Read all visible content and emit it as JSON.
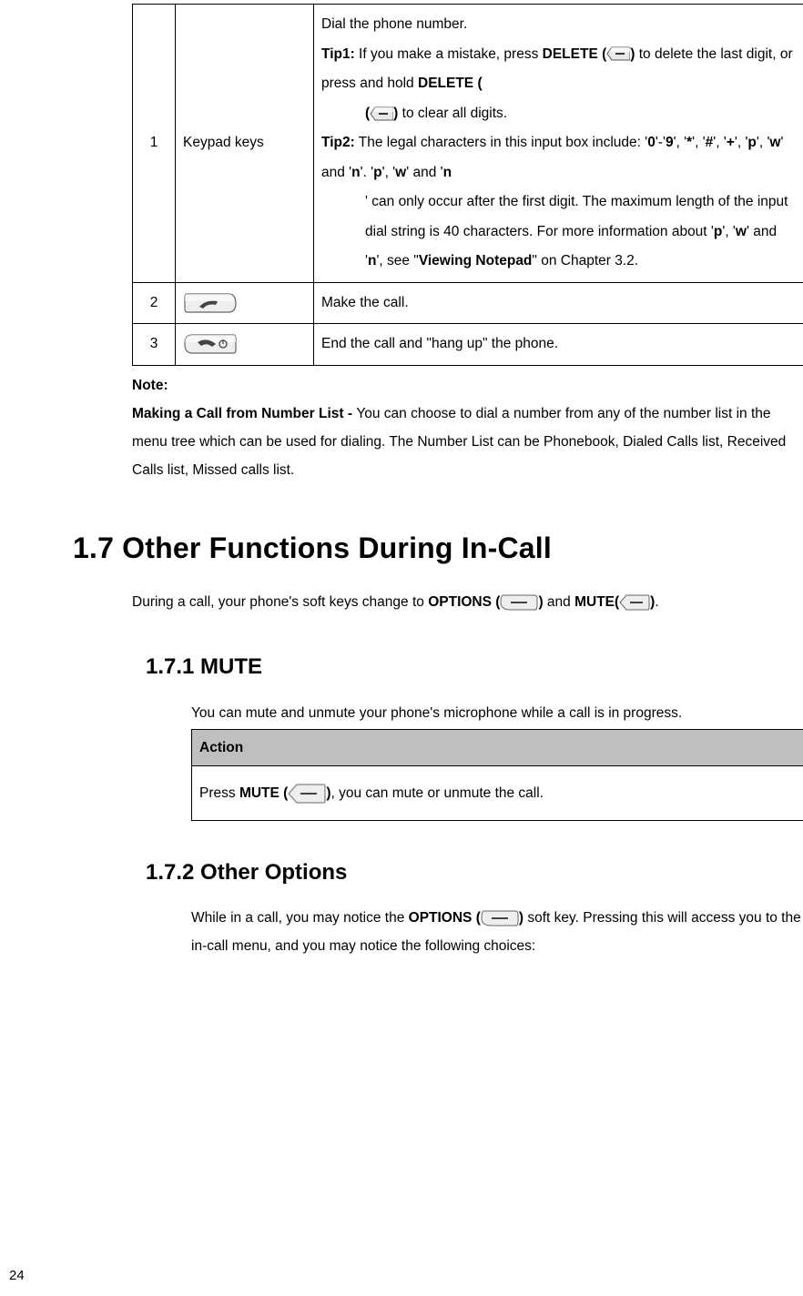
{
  "table1": {
    "rows": [
      {
        "num": "1",
        "label": "Keypad keys",
        "desc": {
          "line1": "Dial the phone number.",
          "tip1_label": "Tip1:",
          "tip1_a": " If you make a mistake, press ",
          "tip1_delete": "DELETE (",
          "tip1_b": ")",
          "tip1_c": " to delete the last digit, or press and hold ",
          "tip1_delete2": "DELETE (",
          "tip1_d": ")",
          "tip1_e": " to clear all digits.",
          "tip2_label": "Tip2:",
          "tip2_a": " The legal characters in this input box include: '",
          "tip2_b0": "0",
          "tip2_b1": "'-'",
          "tip2_b2": "9",
          "tip2_b3": "', '",
          "tip2_b4": "*",
          "tip2_b5": "', '",
          "tip2_b6": "#",
          "tip2_b7": "', '",
          "tip2_b8": "+",
          "tip2_b9": "', '",
          "tip2_b10": "p",
          "tip2_b11": "', '",
          "tip2_b12": "w",
          "tip2_b13": "' and '",
          "tip2_b14": "n",
          "tip2_b15": "'. '",
          "tip2_b16": "p",
          "tip2_b17": "', '",
          "tip2_b18": "w",
          "tip2_b19": "' and '",
          "tip2_b20": "n",
          "tip2_b21": "' can only occur after the first digit. The maximum length of the input dial string is 40 characters. For more information about '",
          "tip2_b22": "p",
          "tip2_b23": "', '",
          "tip2_b24": "w",
          "tip2_b25": "' and '",
          "tip2_b26": "n",
          "tip2_b27": "', see \"",
          "tip2_b28": "Viewing Notepad",
          "tip2_b29": "\" on Chapter 3.2."
        }
      },
      {
        "num": "2",
        "desc": "Make the call."
      },
      {
        "num": "3",
        "desc": "End the call and \"hang up\" the phone."
      }
    ]
  },
  "note": {
    "label": "Note:",
    "bold_lead": "Making a Call from Number List - ",
    "rest": "You can choose to dial a number from any of the number list in the menu tree which can be used for dialing. The Number List can be Phonebook, Dialed Calls list, Received Calls list, Missed calls list."
  },
  "sec17": {
    "heading": "1.7   Other Functions During In-Call",
    "intro_a": "During a call, your phone's soft keys change to ",
    "intro_opt": "OPTIONS (",
    "intro_b": ")",
    "intro_c": " and ",
    "intro_mute": "MUTE(",
    "intro_d": ")",
    "intro_e": "."
  },
  "sec171": {
    "heading": "1.7.1    MUTE",
    "intro": "You can mute and unmute your phone's microphone while a call is in progress.",
    "action_header": "Action",
    "action_a": "Press ",
    "action_mute": "MUTE (",
    "action_b": ")",
    "action_c": ", you can mute or unmute the call."
  },
  "sec172": {
    "heading": "1.7.2    Other Options",
    "body_a": "While in a call, you may notice the ",
    "body_opt": "OPTIONS (",
    "body_b": ")",
    "body_c": " soft key. Pressing this will access you to the in-call menu, and you may notice the following choices:"
  },
  "page_number": "24"
}
